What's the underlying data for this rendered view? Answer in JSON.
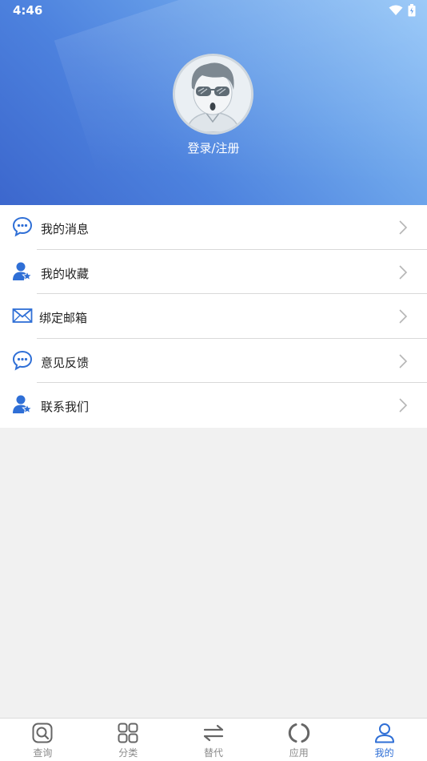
{
  "status_bar": {
    "time": "4:46"
  },
  "profile": {
    "login_label": "登录/注册"
  },
  "menu": {
    "items": [
      {
        "label": "我的消息",
        "icon": "chat-bubble-icon"
      },
      {
        "label": "我的收藏",
        "icon": "user-star-icon"
      },
      {
        "label": "绑定邮箱",
        "icon": "envelope-icon"
      },
      {
        "label": "意见反馈",
        "icon": "chat-bubble-icon"
      },
      {
        "label": "联系我们",
        "icon": "user-star-icon"
      }
    ]
  },
  "tabbar": {
    "tabs": [
      {
        "label": "查询",
        "icon": "search-icon"
      },
      {
        "label": "分类",
        "icon": "grid-icon"
      },
      {
        "label": "替代",
        "icon": "swap-icon"
      },
      {
        "label": "应用",
        "icon": "ring-icon"
      },
      {
        "label": "我的",
        "icon": "person-icon",
        "active": true
      }
    ]
  },
  "colors": {
    "accent": "#2f6fd6",
    "header_start": "#3c67cd",
    "header_end": "#8fc3f7"
  }
}
